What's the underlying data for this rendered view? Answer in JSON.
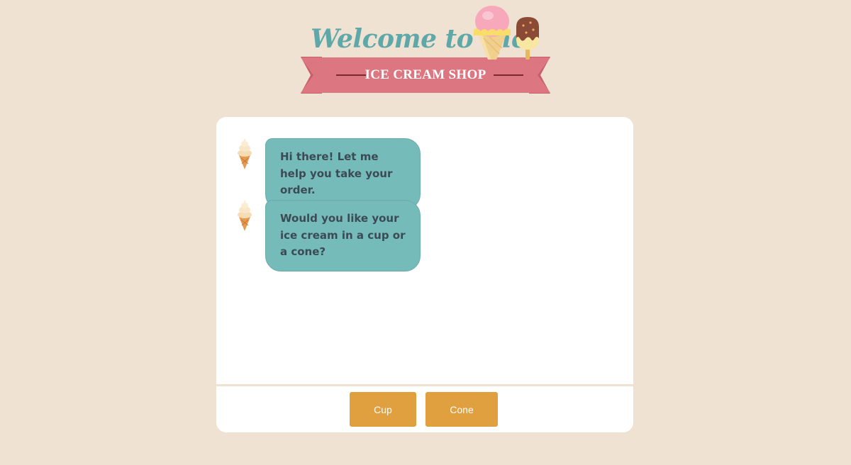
{
  "header": {
    "welcome_text": "Welcome to the",
    "shop_name": "ICE CREAM SHOP"
  },
  "colors": {
    "background": "#efe2d2",
    "welcome_teal": "#5fa8a9",
    "ribbon_pink": "#dc7680",
    "bubble_teal": "#74bbb9",
    "bubble_text": "#3c4a55",
    "button_orange": "#e0a03f"
  },
  "chat": {
    "messages": [
      {
        "sender_icon": "ice-cream-cone-icon",
        "text": "Hi there! Let me help you take your order."
      },
      {
        "sender_icon": "ice-cream-cone-icon",
        "text": "Would you like your ice cream in a cup or a cone?"
      }
    ],
    "options": [
      {
        "label": "Cup"
      },
      {
        "label": "Cone"
      }
    ]
  }
}
